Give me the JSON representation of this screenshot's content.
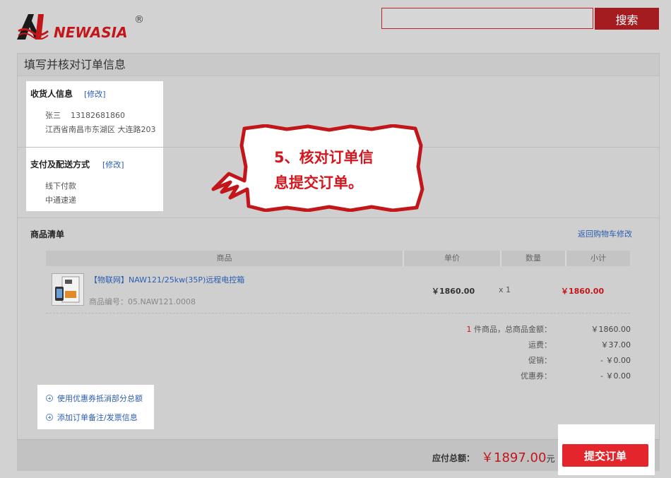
{
  "brand": {
    "name": "NEWASIA",
    "reg": "®"
  },
  "search": {
    "button_label": "搜索",
    "value": ""
  },
  "panel": {
    "title": "填写并核对订单信息"
  },
  "consignee": {
    "title": "收货人信息",
    "edit": "[修改]",
    "name_phone": "张三    13182681860",
    "address": "江西省南昌市东湖区 大连路203"
  },
  "payment": {
    "title": "支付及配送方式",
    "edit": "[修改]",
    "pay_method": "线下付款",
    "shipping": "中通速递"
  },
  "callout": {
    "line1": "5、核对订单信",
    "line2": "息提交订单。"
  },
  "goods": {
    "title": "商品清单",
    "back_link": "返回购物车修改",
    "columns": [
      "商品",
      "单价",
      "数量",
      "小计"
    ],
    "item": {
      "name": "【物联网】NAW121/25kw(35P)远程电控箱",
      "code": "商品编号：05.NAW121.0008",
      "price": "￥1860.00",
      "qty": "x 1",
      "subtotal": "￥1860.00"
    }
  },
  "summary": {
    "count": "1",
    "count_label": " 件商品，总商品金额：",
    "goods_total": "￥1860.00",
    "shipping_label": "运费：",
    "shipping": "￥37.00",
    "promo_label": "促销：",
    "promo": "- ￥0.00",
    "coupon_label": "优惠券：",
    "coupon": "- ￥0.00"
  },
  "options": {
    "coupon": "使用优惠券抵消部分总额",
    "remark": "添加订单备注/发票信息"
  },
  "footer": {
    "total_label": "应付总额：",
    "total": "￥1897.00",
    "unit": "元",
    "submit": "提交订单"
  },
  "colors": {
    "brand_red": "#c3161b",
    "link_blue": "#2a5db0",
    "button_red": "#e4252b"
  }
}
